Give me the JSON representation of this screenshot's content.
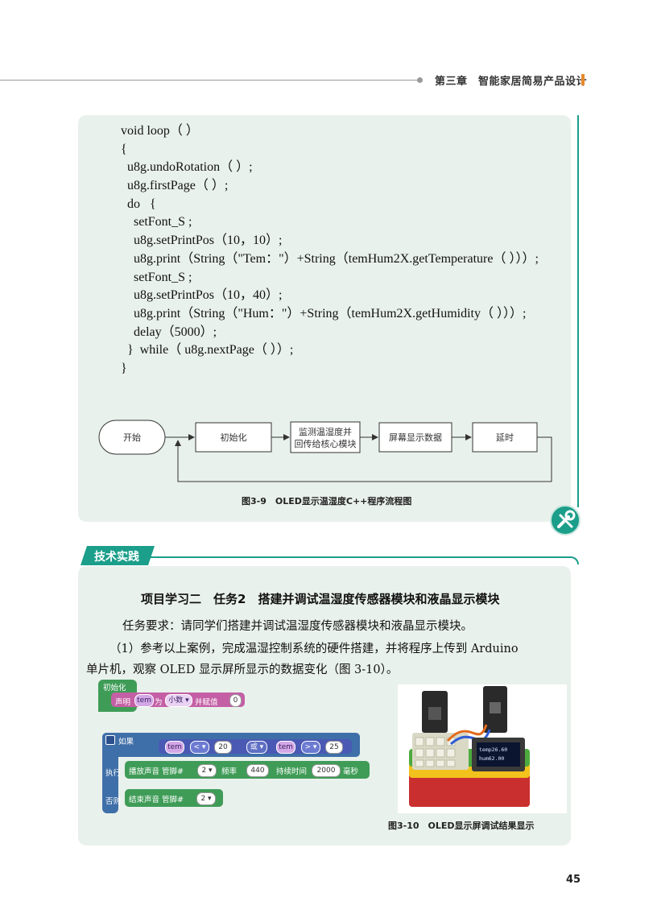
{
  "header": {
    "chapter_title": "第三章　智能家居简易产品设计"
  },
  "code": {
    "lines": [
      "void loop（ ）",
      "{",
      "  u8g.undoRotation（ ）;",
      "  u8g.firstPage（ ）;",
      "  do   {",
      "    setFont_S ;",
      "    u8g.setPrintPos（10，10）;",
      "    u8g.print（String（\"Tem：\"）+String（temHum2X.getTemperature（ ）））;",
      "    setFont_S ;",
      "    u8g.setPrintPos（10，40）;",
      "    u8g.print（String（\"Hum：\"）+String（temHum2X.getHumidity（ ）））;",
      "    delay（5000）;",
      "  }  while（ u8g.nextPage（ ））;",
      "}"
    ]
  },
  "flowchart": {
    "start": "开始",
    "init": "初始化",
    "monitor_line1": "监测温湿度并",
    "monitor_line2": "回传给核心模块",
    "display": "屏幕显示数据",
    "delay": "延时",
    "caption": "图3-9　OLED显示温湿度C++程序流程图"
  },
  "practice": {
    "tag": "技术实践",
    "title": "项目学习二　任务2　搭建并调试温湿度传感器模块和液晶显示模块",
    "requirement": "任务要求：请同学们搭建并调试温湿度传感器模块和液晶显示模块。",
    "step1_line1": "（1）参考以上案例，完成温湿控制系统的硬件搭建，并将程序上传到 Arduino",
    "step1_line2": "单片机，观察 OLED 显示屏所显示的数据变化（图 3-10）。"
  },
  "blocks": {
    "init_label": "初始化",
    "declare": "声明",
    "var_tem": "tem",
    "as": "为",
    "type_decimal": "小数 ▾",
    "assign": "并赋值",
    "zero": "0",
    "if": "如果",
    "lt": "< ▾",
    "num_20": "20",
    "or": "或 ▾",
    "gt": "> ▾",
    "num_25": "25",
    "then": "执行",
    "play_tone": "播放声音 管脚#",
    "pin_2": "2 ▾",
    "freq": "频率",
    "num_440": "440",
    "duration": "持续时间",
    "num_2000": "2000",
    "ms": "毫秒",
    "else": "否则",
    "stop_tone": "结束声音 管脚#"
  },
  "photo": {
    "screen_line1": "temp26.60",
    "screen_line2": "hum62.00",
    "caption": "图3-10　OLED显示屏调试结果显示"
  },
  "page_number": "45",
  "colors": {
    "accent": "#1b9e8a",
    "panel": "#e9f1ec",
    "chapter_bar": "#e6892c"
  }
}
